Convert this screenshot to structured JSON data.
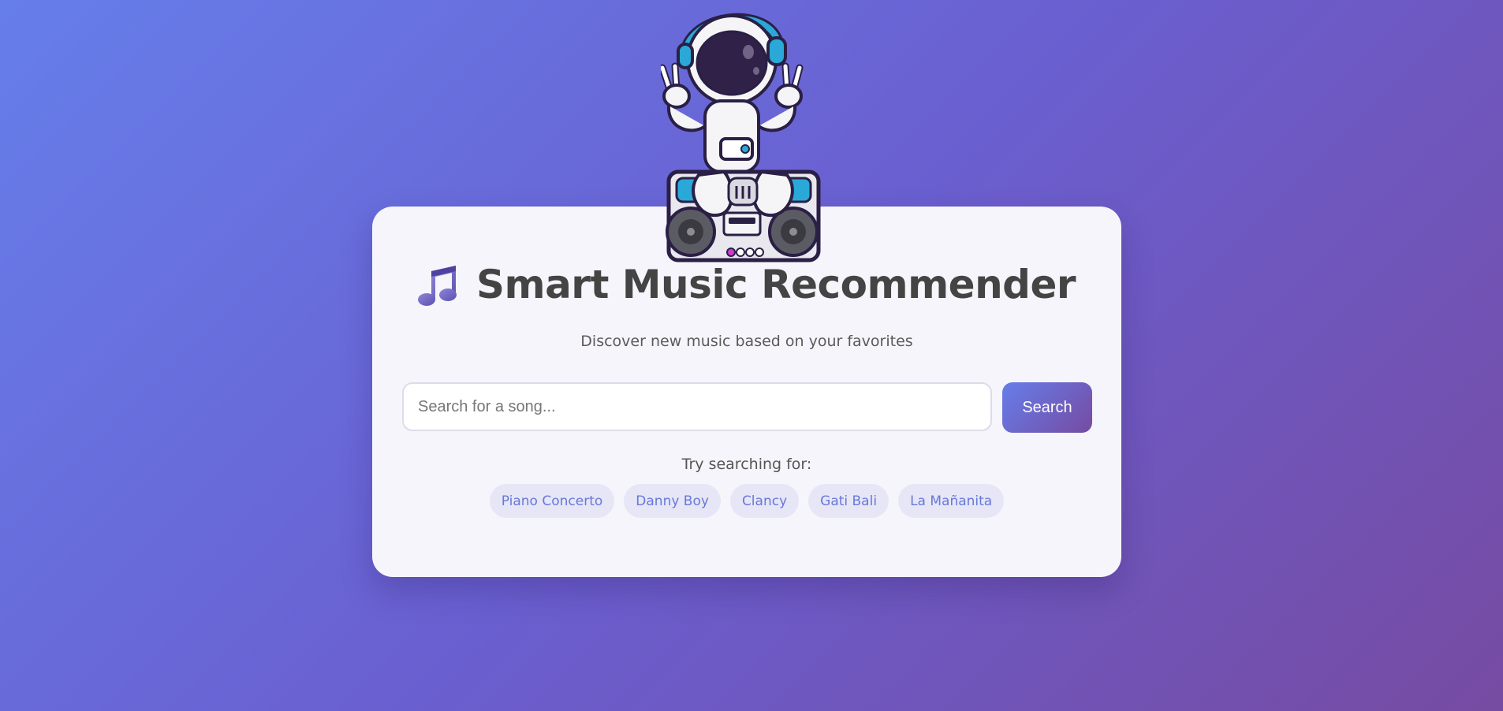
{
  "header": {
    "title": "Smart Music Recommender",
    "subtitle": "Discover new music based on your favorites",
    "title_icon": "music-note-icon",
    "mascot": "astronaut-boombox-illustration"
  },
  "search": {
    "placeholder": "Search for a song...",
    "value": "",
    "button_label": "Search"
  },
  "suggestions": {
    "label": "Try searching for:",
    "items": [
      "Piano Concerto",
      "Danny Boy",
      "Clancy",
      "Gati Bali",
      "La Mañanita"
    ]
  },
  "colors": {
    "background_start": "#667eea",
    "background_end": "#764ba2",
    "card": "#f6f5fb",
    "chip_bg": "#e6e6f7",
    "chip_text": "#6878d8",
    "title_text": "#444444"
  }
}
